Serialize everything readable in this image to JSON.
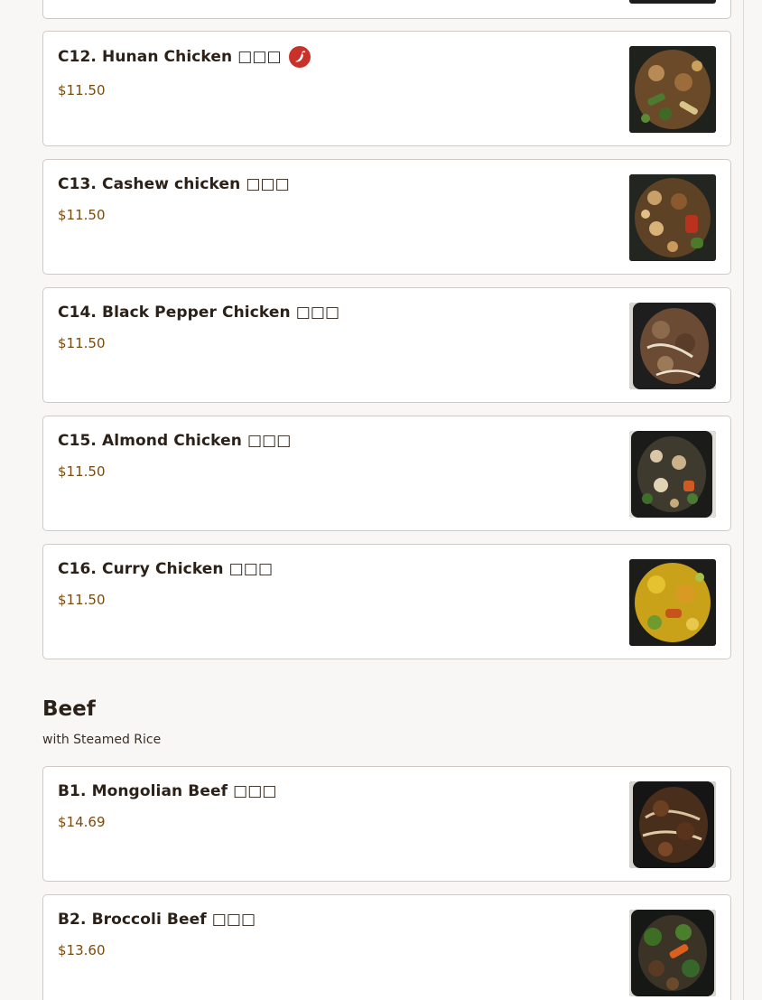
{
  "sections": [
    {
      "items": [
        {
          "name": "C12. Hunan Chicken □□□",
          "price": "$11.50",
          "spicy": true,
          "photo": "hunan-chicken-photo"
        },
        {
          "name": "C13. Cashew chicken □□□",
          "price": "$11.50",
          "photo": "cashew-chicken-photo"
        },
        {
          "name": "C14. Black Pepper Chicken □□□",
          "price": "$11.50",
          "photo": "black-pepper-chicken-photo"
        },
        {
          "name": "C15. Almond Chicken □□□",
          "price": "$11.50",
          "photo": "almond-chicken-photo"
        },
        {
          "name": "C16. Curry Chicken □□□",
          "price": "$11.50",
          "photo": "curry-chicken-photo"
        }
      ]
    },
    {
      "title": "Beef",
      "subtitle": "with Steamed Rice",
      "items": [
        {
          "name": "B1. Mongolian Beef □□□",
          "price": "$14.69",
          "photo": "mongolian-beef-photo"
        },
        {
          "name": "B2. Broccoli Beef □□□",
          "price": "$13.60",
          "photo": "broccoli-beef-photo"
        }
      ]
    }
  ],
  "spicy_icon": "chili-pepper-icon",
  "colors": {
    "price": "#7a4b10",
    "spicy_badge": "#c9322a",
    "card_border": "#cfcac6",
    "background": "#f8f7f5"
  }
}
